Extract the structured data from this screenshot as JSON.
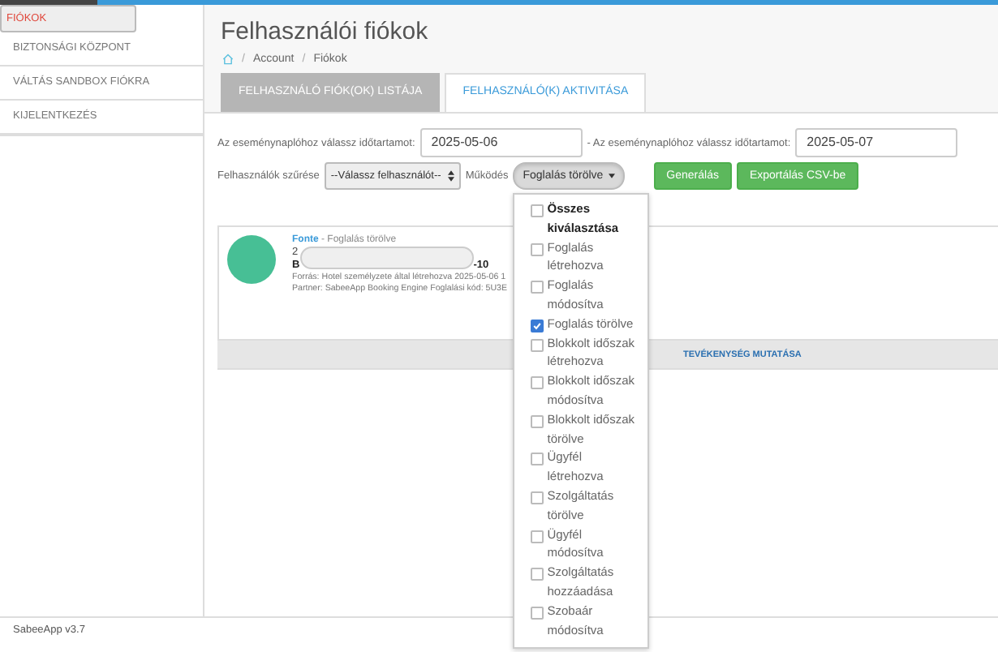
{
  "sidebar": {
    "items": [
      {
        "label": "FIÓKOK",
        "selected": true
      },
      {
        "label": "BIZTONSÁGI KÖZPONT",
        "selected": false
      },
      {
        "label": "VÁLTÁS SANDBOX FIÓKRA",
        "selected": false
      },
      {
        "label": "KIJELENTKEZÉS",
        "selected": false
      }
    ],
    "version": "SabeeApp v3.7"
  },
  "page": {
    "title": "Felhasználói fiókok",
    "breadcrumb": [
      "Account",
      "Fiókok"
    ],
    "separator": "/"
  },
  "tabs": [
    {
      "label": "FELHASZNÁLÓ FIÓK(OK) LISTÁJA",
      "selected": false
    },
    {
      "label": "FELHASZNÁLÓ(K) AKTIVITÁSA",
      "selected": true
    }
  ],
  "filters": {
    "from_label": "Az eseménynaplóhoz válassz időtartamot:",
    "from_value": "2025-05-06",
    "to_label": "- Az eseménynaplóhoz válassz időtartamot:",
    "to_value": "2025-05-07",
    "user_label": "Felhasználók szűrése",
    "user_select": "--Válassz felhasználót--",
    "action_label": "Működés",
    "action_select": "Foglalás törölve",
    "generate": "Generálás",
    "export": "Exportálás CSV-be"
  },
  "action_menu": {
    "expanded": true,
    "items": [
      {
        "kind": "all",
        "label": "Összes kiválasztása",
        "checked": false
      },
      {
        "kind": "option",
        "label": "Foglalás létrehozva",
        "checked": false
      },
      {
        "kind": "option",
        "label": "Foglalás módosítva",
        "checked": false
      },
      {
        "kind": "option",
        "label": "Foglalás törölve",
        "checked": true
      },
      {
        "kind": "option",
        "label": "Blokkolt időszak létrehozva",
        "checked": false
      },
      {
        "kind": "option",
        "label": "Blokkolt időszak módosítva",
        "checked": false
      },
      {
        "kind": "option",
        "label": "Blokkolt időszak törölve",
        "checked": false
      },
      {
        "kind": "option",
        "label": "Ügyfél létrehozva",
        "checked": false
      },
      {
        "kind": "option",
        "label": "Szolgáltatás törölve",
        "checked": false
      },
      {
        "kind": "option",
        "label": "Ügyfél módosítva",
        "checked": false
      },
      {
        "kind": "option",
        "label": "Szolgáltatás hozzáadása",
        "checked": false
      },
      {
        "kind": "option",
        "label": "Szobaár módosítva",
        "checked": false
      }
    ]
  },
  "activity": {
    "user": "Fonte",
    "action": " - Foglalás törölve",
    "line_1": "2",
    "line_2_start": "B",
    "line_2_end": "-10",
    "source": "Forrás: Hotel személyzete által létrehozva 2025-05-06 1",
    "partner": "Partner: SabeeApp Booking Engine Foglalási kód: 5U3E",
    "more": "TEVÉKENYSÉG MUTATÁSA"
  }
}
